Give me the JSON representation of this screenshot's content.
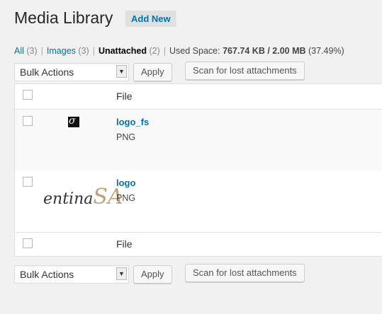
{
  "header": {
    "title": "Media Library",
    "add_new": "Add New"
  },
  "filters": {
    "all_label": "All",
    "all_count": "(3)",
    "images_label": "Images",
    "images_count": "(3)",
    "unattached_label": "Unattached",
    "unattached_count": "(2)",
    "used_space_label": "Used Space:",
    "used_space_value": "767.74 KB / 2.00 MB",
    "used_space_pct": "(37.49%)"
  },
  "tablenav_top": {
    "bulk_actions": "Bulk Actions",
    "apply": "Apply",
    "scan": "Scan for lost attachments"
  },
  "table": {
    "header_file": "File",
    "footer_file": "File",
    "rows": [
      {
        "title": "logo_fs",
        "mime": "PNG",
        "thumb_text": "σ"
      },
      {
        "title": "logo",
        "mime": "PNG",
        "thumb_text_a": "entina",
        "thumb_text_b": "SA"
      }
    ]
  },
  "tablenav_bottom": {
    "bulk_actions": "Bulk Actions",
    "apply": "Apply",
    "scan": "Scan for lost attachments"
  },
  "colors": {
    "link": "#0073aa",
    "background": "#f1f1f1"
  }
}
